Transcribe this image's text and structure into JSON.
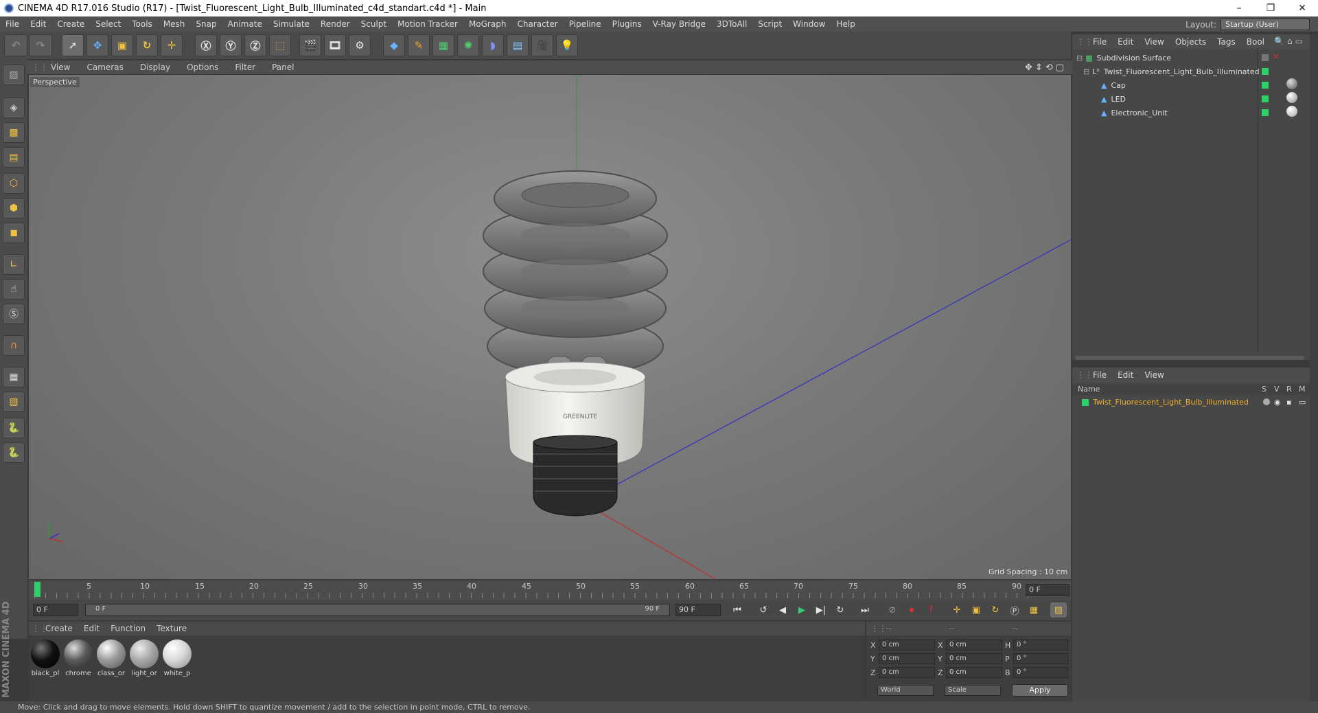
{
  "window": {
    "title": "CINEMA 4D R17.016 Studio (R17) - [Twist_Fluorescent_Light_Bulb_Illuminated_c4d_standart.c4d *] - Main",
    "controls": [
      "–",
      "❐",
      "✕"
    ]
  },
  "menubar": {
    "items": [
      "File",
      "Edit",
      "Create",
      "Select",
      "Tools",
      "Mesh",
      "Snap",
      "Animate",
      "Simulate",
      "Render",
      "Sculpt",
      "Motion Tracker",
      "MoGraph",
      "Character",
      "Pipeline",
      "Plugins",
      "V-Ray Bridge",
      "3DToAll",
      "Script",
      "Window",
      "Help"
    ],
    "layout_label": "Layout:",
    "layout_value": "Startup (User)"
  },
  "viewport": {
    "menu": [
      "View",
      "Cameras",
      "Display",
      "Options",
      "Filter",
      "Panel"
    ],
    "label": "Perspective",
    "grid_spacing": "Grid Spacing : 10 cm"
  },
  "timeline": {
    "ticks": [
      "0",
      "5",
      "10",
      "15",
      "20",
      "25",
      "30",
      "35",
      "40",
      "45",
      "50",
      "55",
      "60",
      "65",
      "70",
      "75",
      "80",
      "85",
      "90"
    ],
    "current_frame": "0 F"
  },
  "transport": {
    "start_field": "0 F",
    "range_start": "0 F",
    "range_end": "90 F",
    "end_field": "90 F"
  },
  "materials": {
    "menu": [
      "Create",
      "Edit",
      "Function",
      "Texture"
    ],
    "items": [
      {
        "label": "black_pl",
        "color": "#111111"
      },
      {
        "label": "chrome",
        "color": "#5a5a5a"
      },
      {
        "label": "class_or",
        "color": "#9a9a9a"
      },
      {
        "label": "light_or",
        "color": "#a8a8a8"
      },
      {
        "label": "white_p",
        "color": "#d8d8d8"
      }
    ]
  },
  "coordinates": {
    "header": [
      "--",
      "--",
      "--"
    ],
    "rows": [
      {
        "a": "X",
        "av": "0 cm",
        "b": "X",
        "bv": "0 cm",
        "c": "H",
        "cv": "0 °"
      },
      {
        "a": "Y",
        "av": "0 cm",
        "b": "Y",
        "bv": "0 cm",
        "c": "P",
        "cv": "0 °"
      },
      {
        "a": "Z",
        "av": "0 cm",
        "b": "Z",
        "bv": "0 cm",
        "c": "B",
        "cv": "0 °"
      }
    ],
    "space": "World",
    "mode": "Scale",
    "apply": "Apply"
  },
  "object_manager": {
    "menu": [
      "File",
      "Edit",
      "View",
      "Objects",
      "Tags",
      "Bool"
    ],
    "objects": [
      {
        "name": "Subdivision Surface",
        "indent": 0
      },
      {
        "name": "Twist_Fluorescent_Light_Bulb_Illuminated",
        "indent": 1
      },
      {
        "name": "Cap",
        "indent": 2
      },
      {
        "name": "LED",
        "indent": 2
      },
      {
        "name": "Electronic_Unit",
        "indent": 2
      }
    ]
  },
  "layer_manager": {
    "menu": [
      "File",
      "Edit",
      "View"
    ],
    "columns": {
      "name": "Name",
      "s": "S",
      "v": "V",
      "r": "R",
      "m": "M"
    },
    "item": "Twist_Fluorescent_Light_Bulb_Illuminated"
  },
  "branding": "MAXON CINEMA 4D",
  "statusbar": {
    "text": "Move: Click and drag to move elements. Hold down SHIFT to quantize movement / add to the selection in point mode, CTRL to remove."
  },
  "colors": {
    "accent_green": "#2fd06a",
    "layer_text": "#f0b030",
    "axis_blue": "#3030c0",
    "axis_red": "#c03030"
  }
}
